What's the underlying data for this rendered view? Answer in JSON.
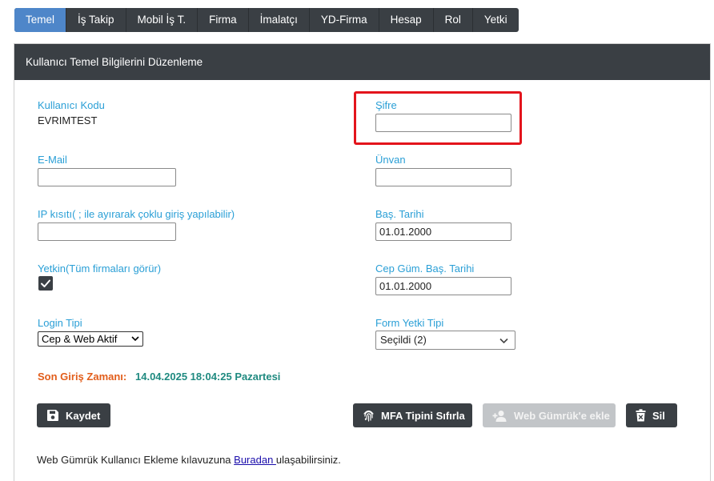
{
  "tabs": [
    {
      "label": "Temel",
      "active": true
    },
    {
      "label": "İş Takip"
    },
    {
      "label": "Mobil İş T."
    },
    {
      "label": "Firma"
    },
    {
      "label": "İmalatçı"
    },
    {
      "label": "YD-Firma"
    },
    {
      "label": "Hesap"
    },
    {
      "label": "Rol"
    },
    {
      "label": "Yetki"
    }
  ],
  "panel": {
    "title": "Kullanıcı Temel Bilgilerini Düzenleme"
  },
  "form": {
    "user_code_label": "Kullanıcı Kodu",
    "user_code_value": "EVRIMTEST",
    "password_label": "Şifre",
    "password_value": "",
    "email_label": "E-Mail",
    "email_value": "",
    "title_label": "Ünvan",
    "title_value": "",
    "ip_label": "IP kısıtı( ; ile ayırarak çoklu giriş yapılabilir)",
    "ip_value": "",
    "start_date_label": "Baş. Tarihi",
    "start_date_value": "01.01.2000",
    "authority_label": "Yetkin(Tüm firmaları görür)",
    "authority_checked": true,
    "mobile_customs_start_label": "Cep Güm. Baş. Tarihi",
    "mobile_customs_start_value": "01.01.2000",
    "login_type_label": "Login Tipi",
    "login_type_value": "Cep & Web Aktif",
    "form_auth_type_label": "Form Yetki Tipi",
    "form_auth_type_value": "Seçildi (2)"
  },
  "last_login": {
    "label": "Son Giriş Zamanı:",
    "value": "14.04.2025 18:04:25 Pazartesi"
  },
  "buttons": {
    "save": "Kaydet",
    "reset_mfa": "MFA Tipini Sıfırla",
    "add_web_customs": "Web Gümrük'e ekle",
    "delete": "Sil"
  },
  "footer": {
    "prefix": "Web Gümrük Kullanıcı Ekleme kılavuzuna ",
    "link": "Buradan ",
    "suffix": "ulaşabilirsiniz."
  },
  "colors": {
    "accent": "#2a9fd6",
    "dark": "#3a3f44",
    "active_tab": "#4e86c9",
    "highlight": "#e3141c",
    "warning": "#e25d1a",
    "success": "#1f8a80"
  }
}
